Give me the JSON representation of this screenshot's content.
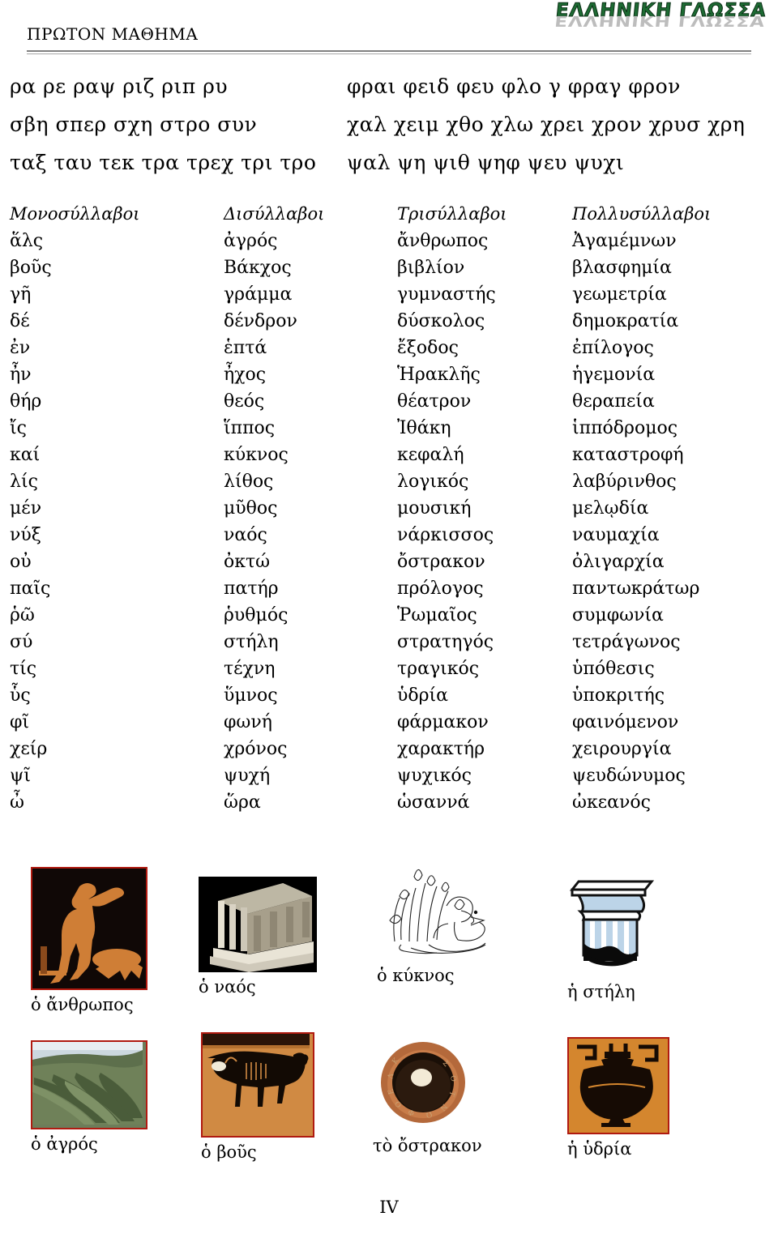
{
  "logo": {
    "text": "ΕΛΛΗΝΙΚΗ ΓΛΩΣΣΑ",
    "shadow_text": "ΕΛΛΗΝΙΚΗ ΓΛΩΣΣΑ",
    "color": "#1d6b33",
    "shadow_color": "#bdbdbd"
  },
  "lesson": {
    "title": "ΠΡΩΤΟΝ ΜΑΘΗΜΑ"
  },
  "syllable_rows": [
    {
      "left": "ρα ρε ραψ ριζ ριπ ρυ",
      "right": "φραι φειδ φευ φλο γ φραγ φρον"
    },
    {
      "left": "σβη σπερ σχη στρο συν",
      "right": "χαλ χειμ χθο χλω χρει χρον χρυσ χρη"
    },
    {
      "left": "ταξ ταυ τεκ τρα τρεχ τρι τρο",
      "right": "ψαλ ψη ψιθ ψηφ ψευ ψυχι"
    }
  ],
  "word_table": {
    "headers": [
      "Μονοσύλλαβοι",
      "Δισύλλαβοι",
      "Τρισύλλαβοι",
      "Πολλυσύλλαβοι"
    ],
    "rows": [
      [
        "ἅλς",
        "ἀγρός",
        "ἄνθρωπος",
        "Ἀγαμέμνων"
      ],
      [
        "βοῦς",
        "Βάκχος",
        "βιβλίον",
        "βλασφημία"
      ],
      [
        "γῆ",
        "γράμμα",
        "γυμναστής",
        "γεωμετρία"
      ],
      [
        "δέ",
        "δένδρον",
        "δύσκολος",
        "δημοκρατία"
      ],
      [
        "ἐν",
        "ἑπτά",
        "ἔξοδος",
        "ἐπίλογος"
      ],
      [
        "ἦν",
        "ἦχος",
        "Ἡρακλῆς",
        "ἡγεμονία"
      ],
      [
        "θήρ",
        "θεός",
        "θέατρον",
        "θεραπεία"
      ],
      [
        "ἴς",
        "ἵππος",
        "Ἰθάκη",
        "ἱππόδρομος"
      ],
      [
        "καί",
        "κύκνος",
        "κεφαλή",
        "καταστροφή"
      ],
      [
        "λίς",
        "λίθος",
        "λογικός",
        "λαβύρινθος"
      ],
      [
        "μέν",
        "μῦθος",
        "μουσική",
        "μελῳδία"
      ],
      [
        "νύξ",
        "ναός",
        "νάρκισσος",
        "ναυμαχία"
      ],
      [
        "οὐ",
        "ὀκτώ",
        "ὄστρακον",
        "ὀλιγαρχία"
      ],
      [
        "παῖς",
        "πατήρ",
        "πρόλογος",
        "παντωκράτωρ"
      ],
      [
        "ῥῶ",
        "ῥυθμός",
        "Ῥωμαῖος",
        "συμφωνία"
      ],
      [
        "σύ",
        "στήλη",
        "στρατηγός",
        "τετράγωνος"
      ],
      [
        "τίς",
        "τέχνη",
        "τραγικός",
        "ὑπόθεσις"
      ],
      [
        "ὗς",
        "ὕμνος",
        "ὑδρία",
        "ὑποκριτής"
      ],
      [
        "φῖ",
        "φωνή",
        "φάρμακον",
        "φαινόμενον"
      ],
      [
        "χείρ",
        "χρόνος",
        "χαρακτήρ",
        "χειρουργία"
      ],
      [
        "ψῖ",
        "ψυχή",
        "ψυχικός",
        "ψευδώνυμος"
      ],
      [
        "ὦ",
        "ὥρα",
        "ὡσαννά",
        "ὠκεανός"
      ]
    ]
  },
  "gallery": {
    "figures": [
      {
        "caption": "ὁ ἄνθρωπος",
        "icon": "red-figure-vase-athlete-image"
      },
      {
        "caption": "ὁ ναός",
        "icon": "greek-temple-photo"
      },
      {
        "caption": "ὁ κύκνος",
        "icon": "swan-line-drawing"
      },
      {
        "caption": "ἡ στήλη",
        "icon": "doric-column-capital-drawing"
      },
      {
        "caption": "ὁ ἀγρός",
        "icon": "vineyard-field-photo"
      },
      {
        "caption": "ὁ βοῦς",
        "icon": "black-figure-vase-ox-image"
      },
      {
        "caption": "τὸ ὄστρακον",
        "icon": "ostrakon-pottery-shard-photo"
      },
      {
        "caption": "ἡ ὑδρία",
        "icon": "black-figure-hydria-vessel-image"
      }
    ]
  },
  "footer": {
    "page_number": "IV"
  }
}
